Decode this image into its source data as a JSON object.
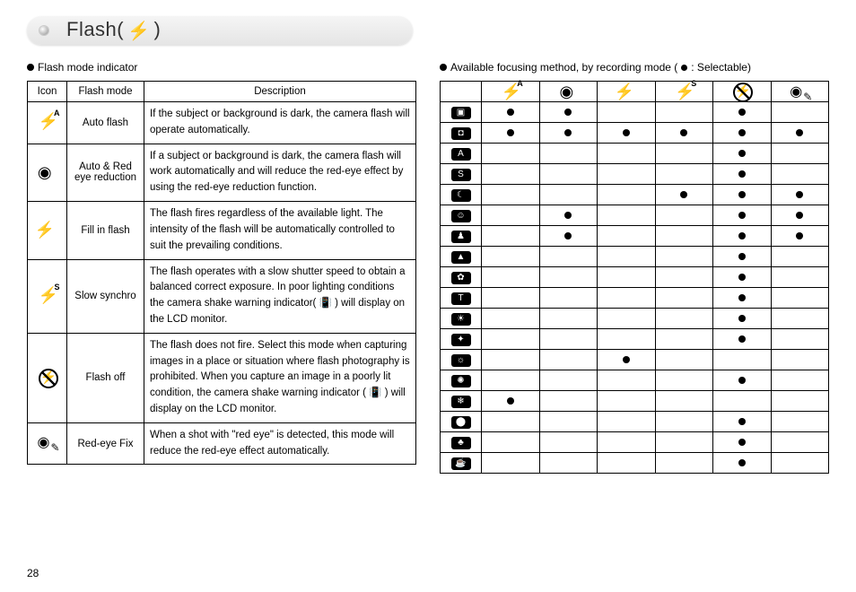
{
  "page_number": "28",
  "title_prefix": "Flash(",
  "title_suffix": ")",
  "left": {
    "heading": "Flash mode indicator",
    "columns": {
      "icon": "Icon",
      "mode": "Flash mode",
      "desc": "Description"
    },
    "rows": [
      {
        "icon": "flash-auto-icon",
        "mode": "Auto flash",
        "desc": "If the subject or background is dark, the camera flash will operate automatically."
      },
      {
        "icon": "red-eye-icon",
        "mode": "Auto & Red eye reduction",
        "desc": "If a subject or background is dark, the camera flash will work automatically and will reduce the red-eye effect by using the red-eye reduction function."
      },
      {
        "icon": "flash-fill-icon",
        "mode": "Fill in flash",
        "desc": "The flash fires regardless of the available light. The intensity of the flash will be automatically controlled to suit the prevailing conditions."
      },
      {
        "icon": "flash-slow-icon",
        "mode": "Slow synchro",
        "desc": "The flash operates with a slow shutter speed to obtain a balanced correct exposure. In poor lighting conditions the camera shake warning indicator( 📳 ) will display on the LCD monitor."
      },
      {
        "icon": "flash-off-icon",
        "mode": "Flash off",
        "desc": "The flash does not fire. Select this mode when capturing images in a place or situation where flash photography is prohibited. When you capture an image in a poorly lit condition, the camera shake warning indicator ( 📳 ) will display on the LCD monitor."
      },
      {
        "icon": "red-eye-fix-icon",
        "mode": "Red-eye Fix",
        "desc": "When a shot with \"red eye\" is detected, this mode will reduce the red-eye effect automatically."
      }
    ]
  },
  "right": {
    "heading_prefix": "Available focusing method, by recording mode (",
    "heading_suffix": " : Selectable)",
    "flash_columns": [
      "flash-auto-icon",
      "red-eye-icon",
      "flash-fill-icon",
      "flash-slow-icon",
      "flash-off-icon",
      "red-eye-fix-icon"
    ],
    "rows": [
      {
        "mode": "auto",
        "cells": [
          1,
          1,
          0,
          0,
          1,
          0
        ]
      },
      {
        "mode": "program",
        "cells": [
          1,
          1,
          1,
          1,
          1,
          1
        ]
      },
      {
        "mode": "a-mode",
        "cells": [
          0,
          0,
          0,
          0,
          1,
          0
        ]
      },
      {
        "mode": "s-mode",
        "cells": [
          0,
          0,
          0,
          0,
          1,
          0
        ]
      },
      {
        "mode": "night",
        "cells": [
          0,
          0,
          0,
          1,
          1,
          1
        ]
      },
      {
        "mode": "portrait",
        "cells": [
          0,
          1,
          0,
          0,
          1,
          1
        ]
      },
      {
        "mode": "children",
        "cells": [
          0,
          1,
          0,
          0,
          1,
          1
        ]
      },
      {
        "mode": "landscape",
        "cells": [
          0,
          0,
          0,
          0,
          1,
          0
        ]
      },
      {
        "mode": "closeup",
        "cells": [
          0,
          0,
          0,
          0,
          1,
          0
        ]
      },
      {
        "mode": "text",
        "cells": [
          0,
          0,
          0,
          0,
          1,
          0
        ]
      },
      {
        "mode": "sunset",
        "cells": [
          0,
          0,
          0,
          0,
          1,
          0
        ]
      },
      {
        "mode": "dawn",
        "cells": [
          0,
          0,
          0,
          0,
          1,
          0
        ]
      },
      {
        "mode": "backlight",
        "cells": [
          0,
          0,
          1,
          0,
          0,
          0
        ]
      },
      {
        "mode": "fireworks",
        "cells": [
          0,
          0,
          0,
          0,
          1,
          0
        ]
      },
      {
        "mode": "beach-snow",
        "cells": [
          1,
          0,
          0,
          0,
          0,
          0
        ]
      },
      {
        "mode": "self-portrait",
        "cells": [
          0,
          0,
          0,
          0,
          1,
          0
        ]
      },
      {
        "mode": "food",
        "cells": [
          0,
          0,
          0,
          0,
          1,
          0
        ]
      },
      {
        "mode": "cafe",
        "cells": [
          0,
          0,
          0,
          0,
          1,
          0
        ]
      }
    ]
  }
}
